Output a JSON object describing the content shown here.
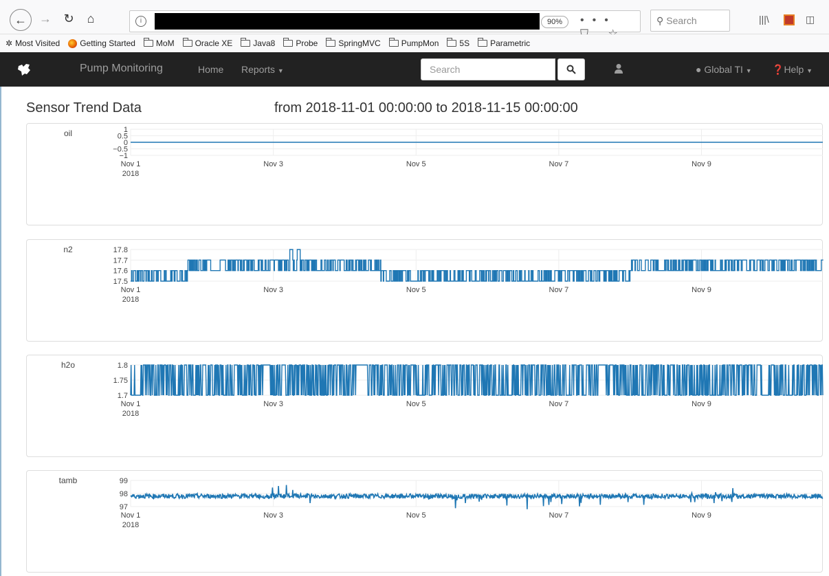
{
  "browser": {
    "zoom": "90%",
    "search_placeholder": "Search",
    "menu_dots": "•••",
    "bookmarks": [
      {
        "label": "Most Visited",
        "icon": "gear-icon"
      },
      {
        "label": "Getting Started",
        "icon": "firefox-icon"
      },
      {
        "label": "MoM",
        "icon": "folder-icon"
      },
      {
        "label": "Oracle XE",
        "icon": "folder-icon"
      },
      {
        "label": "Java8",
        "icon": "folder-icon"
      },
      {
        "label": "Probe",
        "icon": "folder-icon"
      },
      {
        "label": "SpringMVC",
        "icon": "folder-icon"
      },
      {
        "label": "PumpMon",
        "icon": "folder-icon"
      },
      {
        "label": "5S",
        "icon": "folder-icon"
      },
      {
        "label": "Parametric",
        "icon": "folder-icon"
      }
    ]
  },
  "navbar": {
    "brand": "Pump Monitoring",
    "home": "Home",
    "reports": "Reports",
    "search_placeholder": "Search",
    "global": "Global TI",
    "help": "Help"
  },
  "page": {
    "title": "Sensor Trend Data",
    "range": "from 2018-11-01 00:00:00 to 2018-11-15 00:00:00"
  },
  "colors": {
    "trace": "#1f77b4",
    "navbar": "#222222"
  },
  "chart_data": [
    {
      "type": "line",
      "name": "oil",
      "x_ticks": [
        "Nov 1",
        "Nov 3",
        "Nov 5",
        "Nov 7",
        "Nov 9"
      ],
      "x_tick_sub": "2018",
      "x_range_days": [
        0,
        9.7
      ],
      "ylim": [
        -1,
        1
      ],
      "y_ticks": [
        "1",
        "0.5",
        "0",
        "−0.5",
        "−1"
      ],
      "pattern": "flat",
      "base": 0
    },
    {
      "type": "line",
      "name": "n2",
      "x_ticks": [
        "Nov 1",
        "Nov 3",
        "Nov 5",
        "Nov 7",
        "Nov 9"
      ],
      "x_tick_sub": "2018",
      "x_range_days": [
        0,
        9.7
      ],
      "ylim": [
        17.5,
        17.8
      ],
      "y_ticks": [
        "17.8",
        "17.7",
        "17.6",
        "17.5"
      ],
      "pattern": "step",
      "segments": [
        {
          "from": 0,
          "to": 0.8,
          "lo": 17.5,
          "hi": 17.6
        },
        {
          "from": 0.8,
          "to": 3.5,
          "lo": 17.6,
          "hi": 17.7
        },
        {
          "from": 3.5,
          "to": 7.0,
          "lo": 17.5,
          "hi": 17.6
        },
        {
          "from": 7.0,
          "to": 9.7,
          "lo": 17.6,
          "hi": 17.7
        }
      ],
      "spikes": [
        2.25,
        2.35
      ]
    },
    {
      "type": "line",
      "name": "h2o",
      "x_ticks": [
        "Nov 1",
        "Nov 3",
        "Nov 5",
        "Nov 7",
        "Nov 9"
      ],
      "x_tick_sub": "2018",
      "x_range_days": [
        0,
        9.7
      ],
      "ylim": [
        1.7,
        1.8
      ],
      "y_ticks": [
        "1.8",
        "1.75",
        "1.7"
      ],
      "pattern": "binary",
      "lo": 1.7,
      "hi": 1.8
    },
    {
      "type": "line",
      "name": "tamb",
      "x_ticks": [
        "Nov 1",
        "Nov 3",
        "Nov 5",
        "Nov 7",
        "Nov 9"
      ],
      "x_tick_sub": "2018",
      "x_range_days": [
        0,
        9.7
      ],
      "ylim": [
        97,
        99
      ],
      "y_ticks": [
        "99",
        "98",
        "97"
      ],
      "pattern": "noise",
      "base": 97.8
    }
  ]
}
